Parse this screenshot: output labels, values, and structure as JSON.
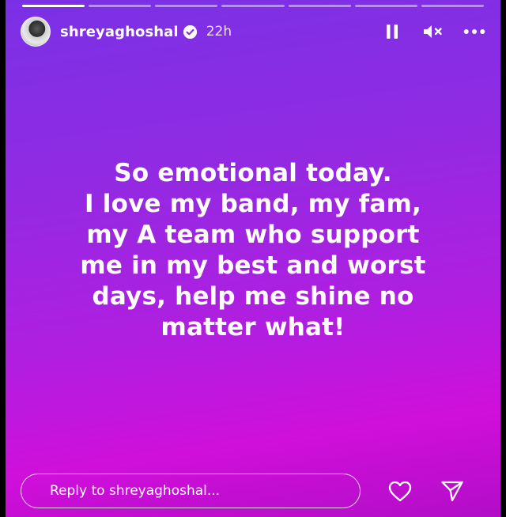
{
  "progress": {
    "segments": [
      1,
      0,
      0,
      0,
      0,
      0,
      0
    ]
  },
  "header": {
    "username": "shreyaghoshal",
    "time": "22h",
    "icons": [
      "pause-icon",
      "mute-icon",
      "more-icon"
    ]
  },
  "story": {
    "lines": [
      "So emotional today.",
      "I love my band, my fam,",
      "my A team who support",
      "me in my best and worst",
      "days, help me shine no",
      "matter what!"
    ]
  },
  "footer": {
    "reply_placeholder": "Reply to shreyaghoshal..."
  },
  "colors": {
    "gradient_top": "#7a31e6",
    "gradient_bottom": "#cf0fda"
  }
}
